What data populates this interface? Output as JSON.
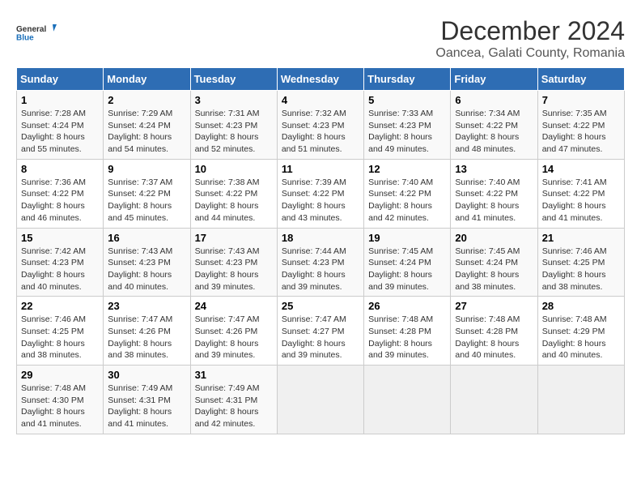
{
  "header": {
    "logo_line1": "General",
    "logo_line2": "Blue",
    "title": "December 2024",
    "subtitle": "Oancea, Galati County, Romania"
  },
  "calendar": {
    "weekdays": [
      "Sunday",
      "Monday",
      "Tuesday",
      "Wednesday",
      "Thursday",
      "Friday",
      "Saturday"
    ],
    "weeks": [
      [
        {
          "day": "1",
          "sunrise": "7:28 AM",
          "sunset": "4:24 PM",
          "daylight": "8 hours and 55 minutes."
        },
        {
          "day": "2",
          "sunrise": "7:29 AM",
          "sunset": "4:24 PM",
          "daylight": "8 hours and 54 minutes."
        },
        {
          "day": "3",
          "sunrise": "7:31 AM",
          "sunset": "4:23 PM",
          "daylight": "8 hours and 52 minutes."
        },
        {
          "day": "4",
          "sunrise": "7:32 AM",
          "sunset": "4:23 PM",
          "daylight": "8 hours and 51 minutes."
        },
        {
          "day": "5",
          "sunrise": "7:33 AM",
          "sunset": "4:23 PM",
          "daylight": "8 hours and 49 minutes."
        },
        {
          "day": "6",
          "sunrise": "7:34 AM",
          "sunset": "4:22 PM",
          "daylight": "8 hours and 48 minutes."
        },
        {
          "day": "7",
          "sunrise": "7:35 AM",
          "sunset": "4:22 PM",
          "daylight": "8 hours and 47 minutes."
        }
      ],
      [
        {
          "day": "8",
          "sunrise": "7:36 AM",
          "sunset": "4:22 PM",
          "daylight": "8 hours and 46 minutes."
        },
        {
          "day": "9",
          "sunrise": "7:37 AM",
          "sunset": "4:22 PM",
          "daylight": "8 hours and 45 minutes."
        },
        {
          "day": "10",
          "sunrise": "7:38 AM",
          "sunset": "4:22 PM",
          "daylight": "8 hours and 44 minutes."
        },
        {
          "day": "11",
          "sunrise": "7:39 AM",
          "sunset": "4:22 PM",
          "daylight": "8 hours and 43 minutes."
        },
        {
          "day": "12",
          "sunrise": "7:40 AM",
          "sunset": "4:22 PM",
          "daylight": "8 hours and 42 minutes."
        },
        {
          "day": "13",
          "sunrise": "7:40 AM",
          "sunset": "4:22 PM",
          "daylight": "8 hours and 41 minutes."
        },
        {
          "day": "14",
          "sunrise": "7:41 AM",
          "sunset": "4:22 PM",
          "daylight": "8 hours and 41 minutes."
        }
      ],
      [
        {
          "day": "15",
          "sunrise": "7:42 AM",
          "sunset": "4:23 PM",
          "daylight": "8 hours and 40 minutes."
        },
        {
          "day": "16",
          "sunrise": "7:43 AM",
          "sunset": "4:23 PM",
          "daylight": "8 hours and 40 minutes."
        },
        {
          "day": "17",
          "sunrise": "7:43 AM",
          "sunset": "4:23 PM",
          "daylight": "8 hours and 39 minutes."
        },
        {
          "day": "18",
          "sunrise": "7:44 AM",
          "sunset": "4:23 PM",
          "daylight": "8 hours and 39 minutes."
        },
        {
          "day": "19",
          "sunrise": "7:45 AM",
          "sunset": "4:24 PM",
          "daylight": "8 hours and 39 minutes."
        },
        {
          "day": "20",
          "sunrise": "7:45 AM",
          "sunset": "4:24 PM",
          "daylight": "8 hours and 38 minutes."
        },
        {
          "day": "21",
          "sunrise": "7:46 AM",
          "sunset": "4:25 PM",
          "daylight": "8 hours and 38 minutes."
        }
      ],
      [
        {
          "day": "22",
          "sunrise": "7:46 AM",
          "sunset": "4:25 PM",
          "daylight": "8 hours and 38 minutes."
        },
        {
          "day": "23",
          "sunrise": "7:47 AM",
          "sunset": "4:26 PM",
          "daylight": "8 hours and 38 minutes."
        },
        {
          "day": "24",
          "sunrise": "7:47 AM",
          "sunset": "4:26 PM",
          "daylight": "8 hours and 39 minutes."
        },
        {
          "day": "25",
          "sunrise": "7:47 AM",
          "sunset": "4:27 PM",
          "daylight": "8 hours and 39 minutes."
        },
        {
          "day": "26",
          "sunrise": "7:48 AM",
          "sunset": "4:28 PM",
          "daylight": "8 hours and 39 minutes."
        },
        {
          "day": "27",
          "sunrise": "7:48 AM",
          "sunset": "4:28 PM",
          "daylight": "8 hours and 40 minutes."
        },
        {
          "day": "28",
          "sunrise": "7:48 AM",
          "sunset": "4:29 PM",
          "daylight": "8 hours and 40 minutes."
        }
      ],
      [
        {
          "day": "29",
          "sunrise": "7:48 AM",
          "sunset": "4:30 PM",
          "daylight": "8 hours and 41 minutes."
        },
        {
          "day": "30",
          "sunrise": "7:49 AM",
          "sunset": "4:31 PM",
          "daylight": "8 hours and 41 minutes."
        },
        {
          "day": "31",
          "sunrise": "7:49 AM",
          "sunset": "4:31 PM",
          "daylight": "8 hours and 42 minutes."
        },
        null,
        null,
        null,
        null
      ]
    ]
  }
}
